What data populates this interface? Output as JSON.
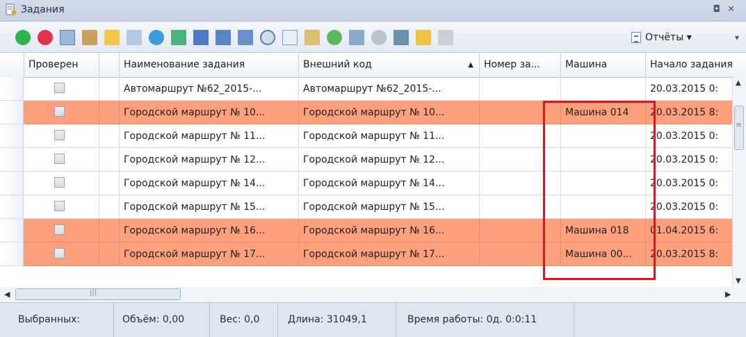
{
  "window": {
    "title": "Задания",
    "icon": "tasks-icon",
    "buttons": [
      "restore-icon",
      "close-icon"
    ]
  },
  "toolbar": {
    "icons": [
      "add-icon",
      "remove-icon",
      "copy-icon",
      "edit-icon",
      "pencil-icon",
      "list-icon",
      "globe-refresh-icon",
      "route-icon",
      "truck-icon",
      "truck-load-icon",
      "truck-unload-icon",
      "clock-icon",
      "document-icon",
      "points-icon",
      "cost-icon",
      "vehicle-icon",
      "pie-chart-icon",
      "export-icon",
      "folder-icon",
      "settings-icon"
    ],
    "reports_label": "Отчёты ▾"
  },
  "grid": {
    "columns": [
      "Проверен",
      "Наименование задания",
      "Внешний код",
      "Номер за...",
      "Машина",
      "Начало задания"
    ],
    "rows": [
      {
        "name": "Автомаршрут №62_2015-...",
        "code": "Автомаршрут №62_2015-...",
        "number": "",
        "machine": "",
        "start": "20.03.2015 0:",
        "highlighted": false
      },
      {
        "name": "Городской маршрут № 10...",
        "code": "Городской маршрут № 10...",
        "number": "",
        "machine": "Машина 014",
        "start": "20.03.2015 8:",
        "highlighted": true
      },
      {
        "name": "Городской маршрут № 11...",
        "code": "Городской маршрут № 11...",
        "number": "",
        "machine": "",
        "start": "20.03.2015 0:",
        "highlighted": false
      },
      {
        "name": "Городской маршрут № 12...",
        "code": "Городской маршрут № 12...",
        "number": "",
        "machine": "",
        "start": "20.03.2015 0:",
        "highlighted": false
      },
      {
        "name": "Городской маршрут № 14...",
        "code": "Городской маршрут № 14...",
        "number": "",
        "machine": "",
        "start": "20.03.2015 0:",
        "highlighted": false
      },
      {
        "name": "Городской маршрут № 15...",
        "code": "Городской маршрут № 15...",
        "number": "",
        "machine": "",
        "start": "20.03.2015 0:",
        "highlighted": false
      },
      {
        "name": "Городской маршрут № 16...",
        "code": "Городской маршрут № 16...",
        "number": "",
        "machine": "Машина 018",
        "start": "01.04.2015 6:",
        "highlighted": true
      },
      {
        "name": "Городской маршрут № 17...",
        "code": "Городской маршрут № 17...",
        "number": "",
        "machine": "Машина 00...",
        "start": "20.03.2015 8:",
        "highlighted": true
      }
    ],
    "sorted_column": "Внешний код",
    "sort_direction": "ascending"
  },
  "statusbar": {
    "selected": "Выбранных:",
    "volume": "Объём: 0,00",
    "weight": "Вес: 0,0",
    "length": "Длина: 31049,1",
    "worktime": "Время работы: 0д. 0:0:11"
  },
  "colors": {
    "highlight_row": "#fea07c",
    "annotation_box": "#e0141e"
  }
}
